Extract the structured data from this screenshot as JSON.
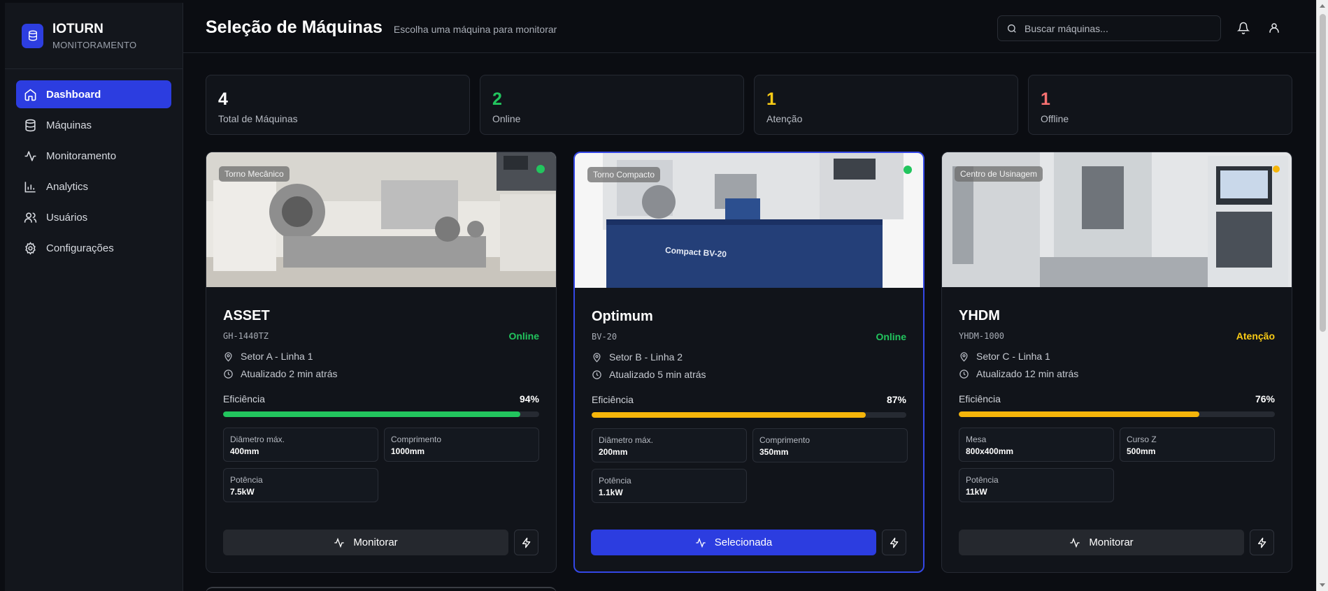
{
  "brand": {
    "name": "IOTURN",
    "subtitle": "MONITORAMENTO"
  },
  "nav": [
    {
      "label": "Dashboard",
      "icon": "home-icon",
      "active": true
    },
    {
      "label": "Máquinas",
      "icon": "database-icon"
    },
    {
      "label": "Monitoramento",
      "icon": "activity-icon"
    },
    {
      "label": "Analytics",
      "icon": "bar-chart-icon"
    },
    {
      "label": "Usuários",
      "icon": "users-icon"
    },
    {
      "label": "Configurações",
      "icon": "gear-icon"
    }
  ],
  "header": {
    "title": "Seleção de Máquinas",
    "subtitle": "Escolha uma máquina para monitorar",
    "search_placeholder": "Buscar máquinas..."
  },
  "stats": [
    {
      "value": "4",
      "label": "Total de Máquinas",
      "color": "#ffffff"
    },
    {
      "value": "2",
      "label": "Online",
      "color": "#22c55e"
    },
    {
      "value": "1",
      "label": "Atenção",
      "color": "#facc15"
    },
    {
      "value": "1",
      "label": "Offline",
      "color": "#f87171"
    }
  ],
  "machines": [
    {
      "type": "Torno Mecânico",
      "name": "ASSET",
      "model": "GH-1440TZ",
      "status": "Online",
      "status_color": "#22c55e",
      "location": "Setor A - Linha 1",
      "updated": "Atualizado 2 min atrás",
      "efficiency_label": "Eficiência",
      "efficiency": "94%",
      "efficiency_value": 94,
      "bar_color": "#22c55e",
      "specs": [
        {
          "label": "Diâmetro máx.",
          "value": "400mm"
        },
        {
          "label": "Comprimento",
          "value": "1000mm"
        },
        {
          "label": "Potência",
          "value": "7.5kW"
        }
      ],
      "action": "Monitorar",
      "selected": false
    },
    {
      "type": "Torno Compacto",
      "name": "Optimum",
      "model": "BV-20",
      "status": "Online",
      "status_color": "#22c55e",
      "location": "Setor B - Linha 2",
      "updated": "Atualizado 5 min atrás",
      "efficiency_label": "Eficiência",
      "efficiency": "87%",
      "efficiency_value": 87,
      "bar_color": "#f5b50a",
      "specs": [
        {
          "label": "Diâmetro máx.",
          "value": "200mm"
        },
        {
          "label": "Comprimento",
          "value": "350mm"
        },
        {
          "label": "Potência",
          "value": "1.1kW"
        }
      ],
      "action": "Selecionada",
      "selected": true,
      "image_text": "Compact BV-20"
    },
    {
      "type": "Centro de Usinagem",
      "name": "YHDM",
      "model": "YHDM-1000",
      "status": "Atenção",
      "status_color": "#facc15",
      "location": "Setor C - Linha 1",
      "updated": "Atualizado 12 min atrás",
      "efficiency_label": "Eficiência",
      "efficiency": "76%",
      "efficiency_value": 76,
      "bar_color": "#f5b50a",
      "specs": [
        {
          "label": "Mesa",
          "value": "800x400mm"
        },
        {
          "label": "Curso Z",
          "value": "500mm"
        },
        {
          "label": "Potência",
          "value": "11kW"
        }
      ],
      "action": "Monitorar",
      "selected": false
    }
  ]
}
